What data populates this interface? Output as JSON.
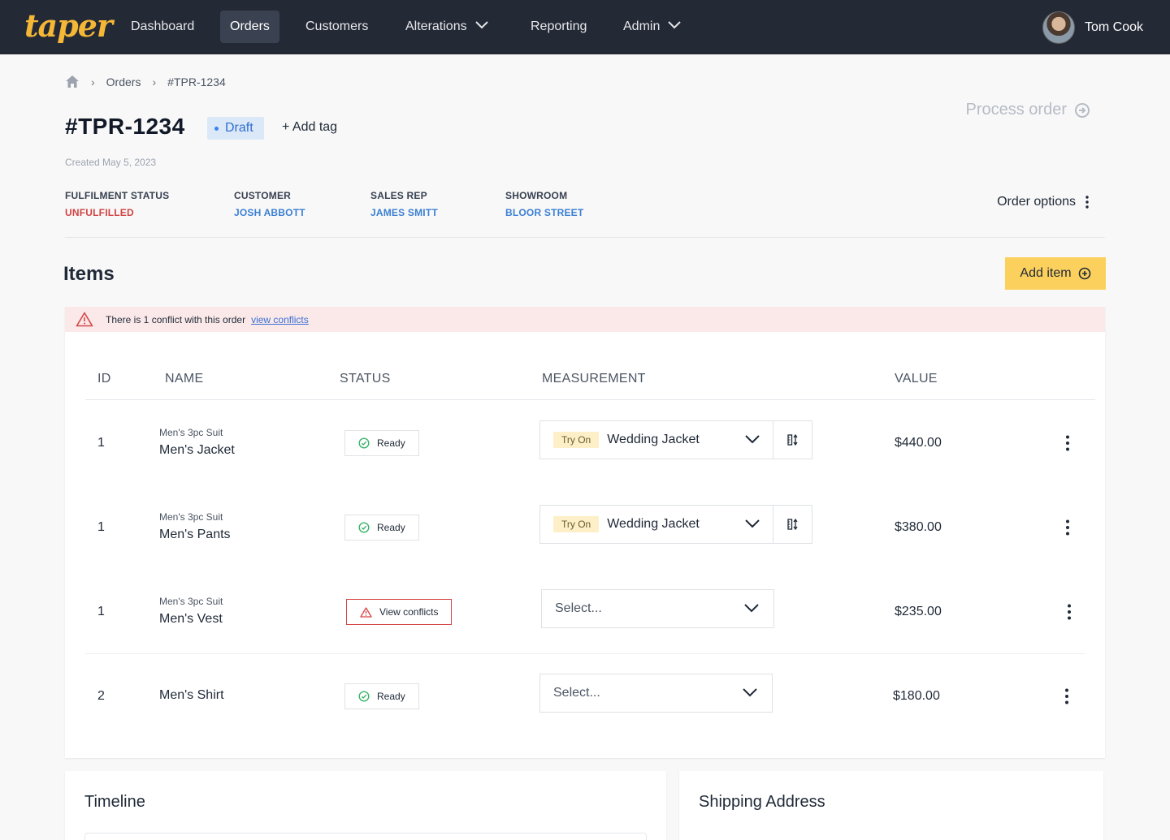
{
  "nav": {
    "logo": "taper",
    "items": [
      "Dashboard",
      "Orders",
      "Customers",
      "Alterations",
      "Reporting",
      "Admin"
    ],
    "user": "Tom Cook"
  },
  "breadcrumb": {
    "orders": "Orders",
    "current": "#TPR-1234"
  },
  "order": {
    "id": "#TPR-1234",
    "badge": "Draft",
    "add_tag": "+ Add tag",
    "created": "Created May 5, 2023",
    "process": "Process order",
    "options": "Order options"
  },
  "meta": [
    {
      "label": "FULFILMENT STATUS",
      "value": "UNFULFILLED",
      "color": "#d14343"
    },
    {
      "label": "CUSTOMER",
      "value": "JOSH ABBOTT",
      "color": "#3b7fd4"
    },
    {
      "label": "SALES REP",
      "value": "JAMES SMITT",
      "color": "#3b7fd4"
    },
    {
      "label": "SHOWROOM",
      "value": "BLOOR STREET",
      "color": "#3b7fd4"
    }
  ],
  "items": {
    "title": "Items",
    "add_label": "Add item",
    "conflict_text": "There is 1 conflict with this order",
    "conflict_link": "view conflicts",
    "headers": [
      "ID",
      "NAME",
      "STATUS",
      "MEASUREMENT",
      "VALUE"
    ],
    "rows": [
      {
        "id": "1",
        "sub": "Men's 3pc Suit",
        "name": "Men's Jacket",
        "status": "Ready",
        "tag": "Try On",
        "measurement": "Wedding Jacket",
        "value": "$440.00"
      },
      {
        "id": "1",
        "sub": "Men's 3pc Suit",
        "name": "Men's Pants",
        "status": "Ready",
        "tag": "Try On",
        "measurement": "Wedding Jacket",
        "value": "$380.00"
      },
      {
        "id": "1",
        "sub": "Men's 3pc Suit",
        "name": "Men's Vest",
        "status": "View conflicts",
        "placeholder": "Select...",
        "value": "$235.00"
      },
      {
        "id": "2",
        "name": "Men's Shirt",
        "status": "Ready",
        "placeholder": "Select...",
        "value": "$180.00"
      }
    ]
  },
  "cards": {
    "timeline": "Timeline",
    "shipping": "Shipping Address"
  },
  "colors": {
    "nav_bg": "#242936",
    "accent": "#fcd05d",
    "link": "#3b7fd4",
    "danger": "#d14343"
  }
}
